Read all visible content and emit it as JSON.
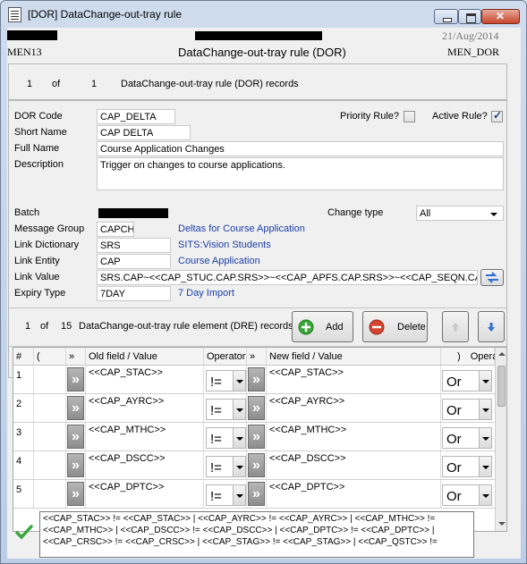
{
  "window": {
    "title": "[DOR] DataChange-out-tray rule"
  },
  "header": {
    "date": "21/Aug/2014",
    "left_code": "MEN13",
    "right_code": "MEN_DOR",
    "form_title": "DataChange-out-tray rule (DOR)"
  },
  "records": {
    "current": "1",
    "of_label": "of",
    "total": "1",
    "label": "DataChange-out-tray rule (DOR) records"
  },
  "form": {
    "dor_code_label": "DOR Code",
    "dor_code": "CAP_DELTA",
    "short_name_label": "Short Name",
    "short_name": "CAP DELTA",
    "full_name_label": "Full Name",
    "full_name": "Course Application Changes",
    "description_label": "Description",
    "description": "Trigger on changes to course applications.",
    "priority_rule_label": "Priority Rule?",
    "priority_rule": false,
    "active_rule_label": "Active Rule?",
    "active_rule": true,
    "batch_label": "Batch",
    "change_type_label": "Change type",
    "change_type": "All",
    "message_group_label": "Message Group",
    "message_group": "CAPCH",
    "message_group_desc": "Deltas for Course Application",
    "link_dictionary_label": "Link Dictionary",
    "link_dictionary": "SRS",
    "link_dictionary_desc": "SITS:Vision Students",
    "link_entity_label": "Link Entity",
    "link_entity": "CAP",
    "link_entity_desc": "Course Application",
    "link_value_label": "Link Value",
    "link_value": "SRS.CAP~<<CAP_STUC.CAP.SRS>>~<<CAP_APFS.CAP.SRS>>~<<CAP_SEQN.CAP.SR",
    "expiry_type_label": "Expiry Type",
    "expiry_type": "7DAY",
    "expiry_type_desc": "7 Day Import"
  },
  "elements": {
    "current": "1",
    "of_label": "of",
    "total": "15",
    "label": "DataChange-out-tray rule element (DRE) records",
    "add_label": "Add",
    "delete_label": "Delete"
  },
  "grid": {
    "headers": {
      "num": "#",
      "open": "(",
      "btn1": "»",
      "old": "Old field / Value",
      "operator": "Operator",
      "btn2": "»",
      "new": "New field / Value",
      "close": ")",
      "operand": "Operand"
    },
    "rows": [
      {
        "num": "1",
        "old": "<<CAP_STAC>>",
        "op": "!=",
        "new": "<<CAP_STAC>>",
        "operand": "Or"
      },
      {
        "num": "2",
        "old": "<<CAP_AYRC>>",
        "op": "!=",
        "new": "<<CAP_AYRC>>",
        "operand": "Or"
      },
      {
        "num": "3",
        "old": "<<CAP_MTHC>>",
        "op": "!=",
        "new": "<<CAP_MTHC>>",
        "operand": "Or"
      },
      {
        "num": "4",
        "old": "<<CAP_DSCC>>",
        "op": "!=",
        "new": "<<CAP_DSCC>>",
        "operand": "Or"
      },
      {
        "num": "5",
        "old": "<<CAP_DPTC>>",
        "op": "!=",
        "new": "<<CAP_DPTC>>",
        "operand": "Or"
      }
    ]
  },
  "condition_summary": "<<CAP_STAC>> != <<CAP_STAC>> | <<CAP_AYRC>> != <<CAP_AYRC>> | <<CAP_MTHC>> != <<CAP_MTHC>> | <<CAP_DSCC>> != <<CAP_DSCC>> | <<CAP_DPTC>> != <<CAP_DPTC>> | <<CAP_CRSC>> != <<CAP_CRSC>> | <<CAP_STAG>> != <<CAP_STAG>> | <<CAP_QSTC>> !=",
  "icons": {
    "title": "form-icon",
    "add": "plus-circle-icon",
    "delete": "minus-circle-icon",
    "up": "arrow-up-icon",
    "down": "arrow-down-icon",
    "valid": "checkmark-icon",
    "link": "swap-link-icon"
  },
  "colors": {
    "link_text": "#1b3ea8",
    "add_green": "#3aa63a",
    "delete_red": "#d64430",
    "arrow_blue": "#2f6fd6",
    "check_green": "#3aa63a"
  }
}
